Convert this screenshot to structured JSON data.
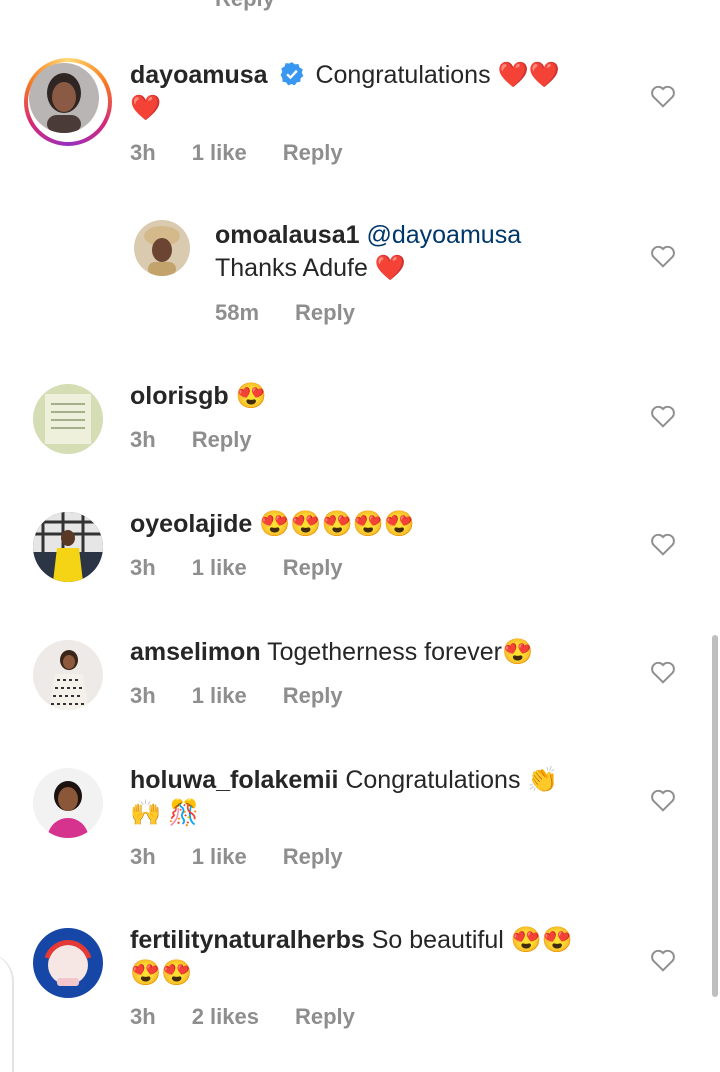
{
  "top": {
    "partial_reply": "Reply"
  },
  "comments": [
    {
      "username": "dayoamusa",
      "verified": true,
      "text": "Congratulations ❤️❤️",
      "text2": "❤️",
      "time": "3h",
      "likes": "1 like",
      "reply": "Reply"
    },
    {
      "username": "omoalausa1",
      "mention": "@dayoamusa",
      "text": "Thanks Adufe ❤️",
      "time": "58m",
      "reply": "Reply"
    },
    {
      "username": "olorisgb",
      "text": "😍",
      "time": "3h",
      "reply": "Reply"
    },
    {
      "username": "oyeolajide",
      "text": "😍😍😍😍😍",
      "time": "3h",
      "likes": "1 like",
      "reply": "Reply"
    },
    {
      "username": "amselimon",
      "text": "Togetherness forever😍",
      "time": "3h",
      "likes": "1 like",
      "reply": "Reply"
    },
    {
      "username": "holuwa_folakemii",
      "text": "Congratulations 👏",
      "text2": "🙌 🎊",
      "time": "3h",
      "likes": "1 like",
      "reply": "Reply"
    },
    {
      "username": "fertilitynaturalherbs",
      "text": "So beautiful 😍😍",
      "text2": "😍😍",
      "time": "3h",
      "likes": "2 likes",
      "reply": "Reply"
    }
  ],
  "icons": {
    "like": "heart-outline-icon",
    "verified": "verified-badge-icon"
  },
  "colors": {
    "verified": "#3897f0",
    "heart": "#ed1c24",
    "meta": "#8e8e8e",
    "mention": "#00376b"
  }
}
